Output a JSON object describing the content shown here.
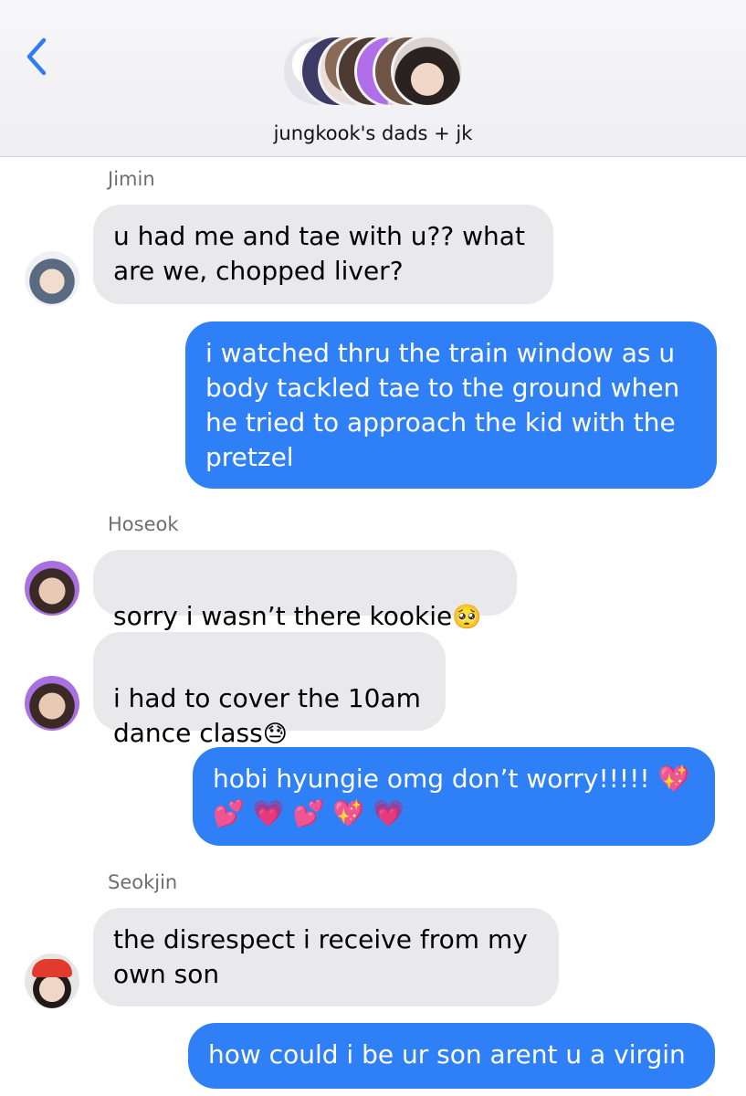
{
  "header": {
    "title": "jungkook's dads + jk"
  },
  "messages": [
    {
      "sender": "Jimin",
      "text": "u had me and tae with u?? what\nare we, chopped liver?"
    },
    {
      "text": "i watched thru the train window as u\nbody tackled tae to the ground when\nhe tried to approach the kid with the\npretzel"
    },
    {
      "sender": "Hoseok",
      "text": "sorry i wasn’t there kookie",
      "emoji": "🥺"
    },
    {
      "text": "i had to cover the 10am\ndance class",
      "emoji": "😓"
    },
    {
      "text": "hobi hyungie omg don’t worry!!!!! 💖\n💕 💗 💕 💖 💗"
    },
    {
      "sender": "Seokjin",
      "text": "the disrespect i receive from my\nown son"
    },
    {
      "text": "how could i be ur son arent u a virgin"
    }
  ],
  "colors": {
    "sent_bubble": "#2f80f6",
    "received_bubble": "#e9e9ec",
    "accent": "#2f7cf6"
  }
}
